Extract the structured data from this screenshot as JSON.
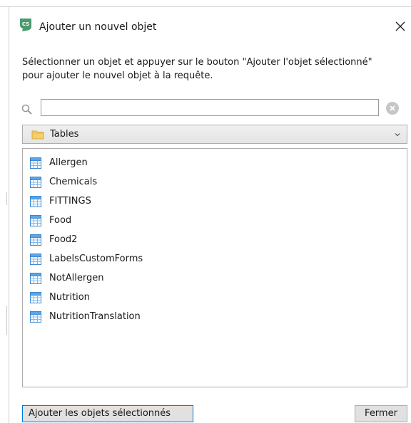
{
  "window": {
    "title": "Ajouter un nouvel objet",
    "app_icon": "cs-app-icon",
    "close_icon": "close-icon"
  },
  "instructions": "Sélectionner un objet et appuyer sur le bouton \"Ajouter l'objet sélectionné\" pour ajouter le nouvel objet à la requête.",
  "search": {
    "value": "",
    "placeholder": "",
    "icon": "search-icon",
    "clear_icon": "clear-icon"
  },
  "category": {
    "selected": "Tables",
    "icon": "folder-icon",
    "chevron_icon": "chevron-down-icon"
  },
  "objects": [
    {
      "label": "Allergen",
      "icon": "table-icon"
    },
    {
      "label": "Chemicals",
      "icon": "table-icon"
    },
    {
      "label": "FITTINGS",
      "icon": "table-icon"
    },
    {
      "label": "Food",
      "icon": "table-icon"
    },
    {
      "label": "Food2",
      "icon": "table-icon"
    },
    {
      "label": "LabelsCustomForms",
      "icon": "table-icon"
    },
    {
      "label": "NotAllergen",
      "icon": "table-icon"
    },
    {
      "label": "Nutrition",
      "icon": "table-icon"
    },
    {
      "label": "NutritionTranslation",
      "icon": "table-icon"
    }
  ],
  "buttons": {
    "add": "Ajouter les objets sélectionnés",
    "close": "Fermer"
  },
  "colors": {
    "accent_border": "#0078d7",
    "button_face": "#e1e1e1",
    "app_icon_green": "#4a9a6e"
  }
}
